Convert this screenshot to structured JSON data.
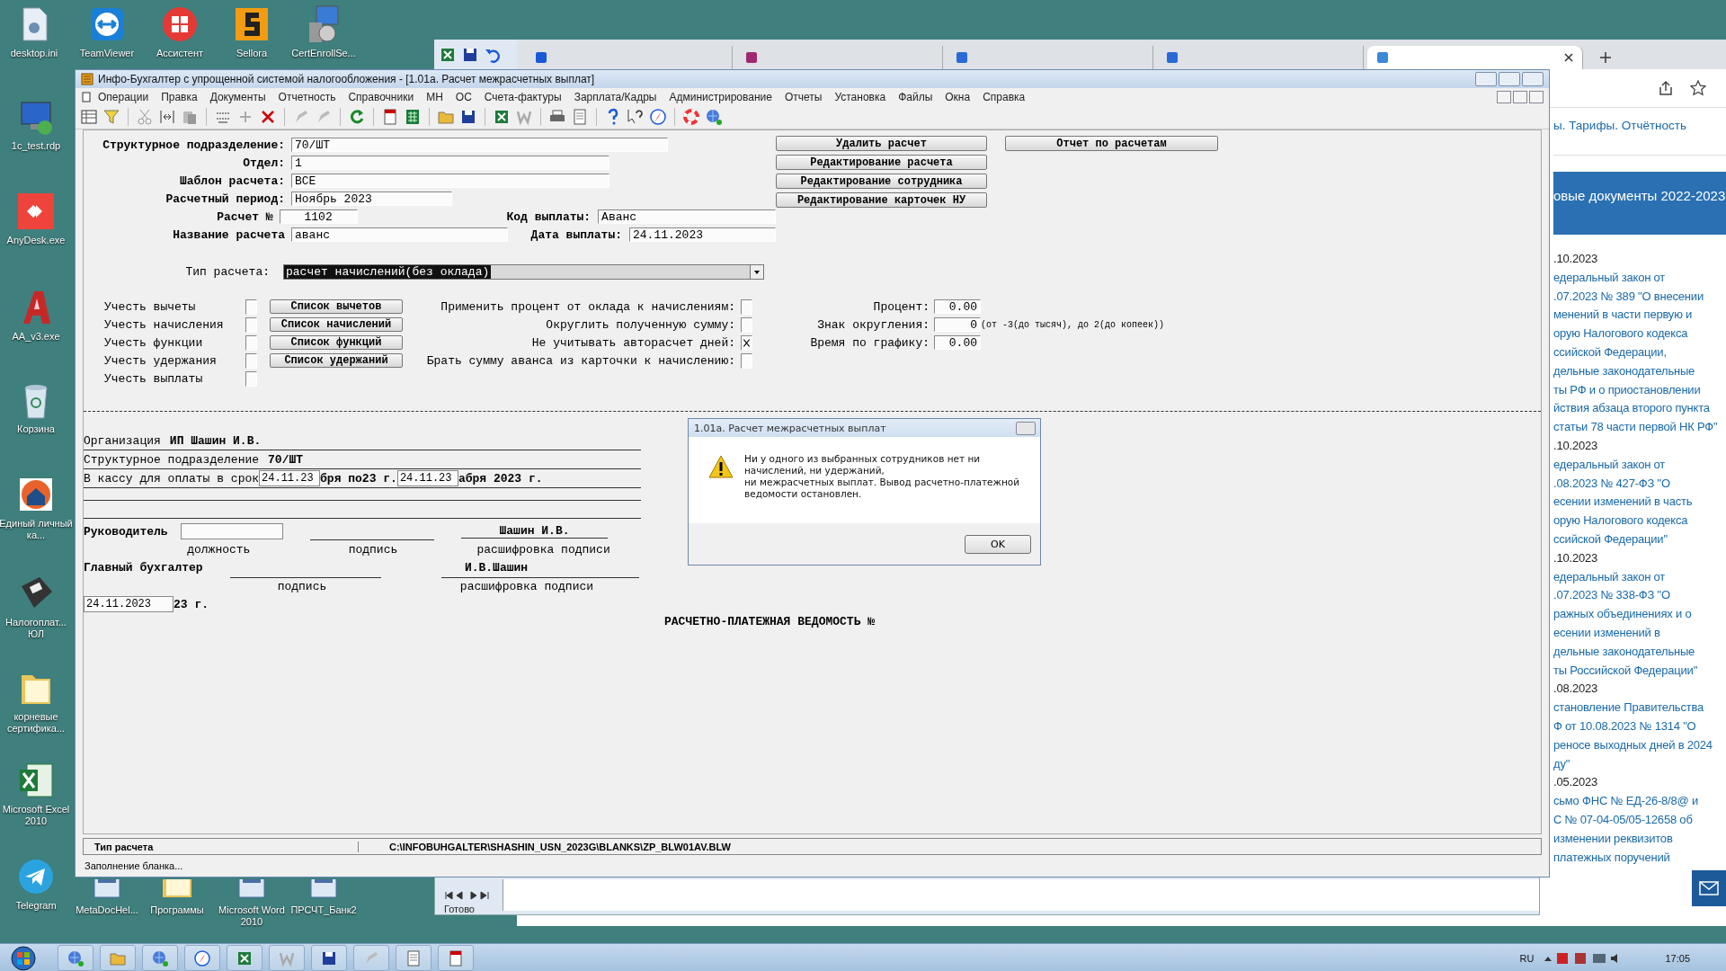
{
  "desktop_icons": [
    {
      "label": "desktop.ini"
    },
    {
      "label": "TeamViewer"
    },
    {
      "label": "Ассистент"
    },
    {
      "label": "Sellora"
    },
    {
      "label": "CertEnrollSe..."
    },
    {
      "label": "1c_test.rdp"
    },
    {
      "label": "AnyDesk.exe"
    },
    {
      "label": "AA_v3.exe"
    },
    {
      "label": "Корзина"
    },
    {
      "label": "Единый личный ка..."
    },
    {
      "label": "Налогоплат... ЮЛ"
    },
    {
      "label": "корневые сертифика..."
    },
    {
      "label": "Microsoft Excel 2010"
    },
    {
      "label": "Telegram"
    },
    {
      "label": "MetaDocHel..."
    },
    {
      "label": "Программы"
    },
    {
      "label": "Microsoft Word 2010"
    },
    {
      "label": "ПРСЧТ_Банк2"
    }
  ],
  "browser": {
    "tabs": [
      {
        "selected": false
      },
      {
        "selected": false
      },
      {
        "selected": false
      },
      {
        "selected": false
      },
      {
        "selected": true
      }
    ],
    "breadcrumb": "ы. Тарифы. Отчётность",
    "banner": "овые документы 2022-2023",
    "lines": [
      {
        "kind": "date",
        "text": ".10.2023"
      },
      {
        "kind": "link",
        "text": "едеральный закон от"
      },
      {
        "kind": "link",
        "text": ".07.2023 № 389 \"О внесении"
      },
      {
        "kind": "link",
        "text": "менений в части первую и"
      },
      {
        "kind": "link",
        "text": "орую Налогового кодекса"
      },
      {
        "kind": "link",
        "text": "ссийской Федерации,"
      },
      {
        "kind": "link",
        "text": "дельные законодательные"
      },
      {
        "kind": "link",
        "text": "ты РФ и о приостановлении"
      },
      {
        "kind": "link",
        "text": "йствия абзаца второго пункта"
      },
      {
        "kind": "link",
        "text": "статьи 78 части первой НК РФ\""
      },
      {
        "kind": "date",
        "text": ".10.2023"
      },
      {
        "kind": "link",
        "text": "едеральный закон от"
      },
      {
        "kind": "link",
        "text": ".08.2023 № 427-ФЗ \"О"
      },
      {
        "kind": "link",
        "text": "есении изменений в часть"
      },
      {
        "kind": "link",
        "text": "орую Налогового кодекса"
      },
      {
        "kind": "link",
        "text": "ссийской Федерации\""
      },
      {
        "kind": "date",
        "text": ".10.2023"
      },
      {
        "kind": "link",
        "text": "едеральный закон от"
      },
      {
        "kind": "link",
        "text": ".07.2023 № 338-ФЗ \"О"
      },
      {
        "kind": "link",
        "text": "ражных объединениях и о"
      },
      {
        "kind": "link",
        "text": "есении изменений в"
      },
      {
        "kind": "link",
        "text": "дельные законодательные"
      },
      {
        "kind": "link",
        "text": "ты Российской Федерации\""
      },
      {
        "kind": "date",
        "text": ".08.2023"
      },
      {
        "kind": "link",
        "text": "становление Правительства"
      },
      {
        "kind": "link",
        "text": "Ф от 10.08.2023 № 1314 \"О"
      },
      {
        "kind": "link",
        "text": "реносе выходных дней в 2024"
      },
      {
        "kind": "link",
        "text": "ду\""
      },
      {
        "kind": "date",
        "text": ".05.2023"
      },
      {
        "kind": "link",
        "text": "сьмо ФНС № ЕД-26-8/8@ и"
      },
      {
        "kind": "link",
        "text": "С № 07-04-05/05-12658 об"
      },
      {
        "kind": "link",
        "text": "изменении реквизитов"
      },
      {
        "kind": "link",
        "text": "платежных поручений"
      }
    ]
  },
  "excel": {
    "status": "Готово"
  },
  "main_window": {
    "title": "Инфо-Бухгалтер с упрощенной системой налогообложения - [1.01а. Расчет межрасчетных выплат]",
    "menu": [
      "Операции",
      "Правка",
      "Документы",
      "Отчетность",
      "Справочники",
      "МН",
      "ОС",
      "Счета-фактуры",
      "Зарплата/Кадры",
      "Администрирование",
      "Отчеты",
      "Установка",
      "Файлы",
      "Окна",
      "Справка"
    ],
    "fields": [
      {
        "label": "Структурное подразделение:",
        "value": "70/ШТ"
      },
      {
        "label": "Отдел:",
        "value": "1"
      },
      {
        "label": "Шаблон расчета:",
        "value": "ВСЕ"
      },
      {
        "label": "Расчетный период:",
        "value": "Ноябрь 2023"
      },
      {
        "label": "Расчет №",
        "value": "1102",
        "extra": {
          "label": "Код выплаты:",
          "value": "Аванс"
        }
      },
      {
        "label": "Название расчета",
        "value": "аванс",
        "extra": {
          "label": "Дата выплаты:",
          "value": "24.11.2023"
        }
      }
    ],
    "actions": [
      "Удалить расчет",
      "Редактирование расчета",
      "Редактирование сотрудника",
      "Редактирование карточек НУ"
    ],
    "report_button": "Отчет по расчетам",
    "calc_type": {
      "label": "Тип расчета:",
      "value": "расчет начислений(без оклада)"
    },
    "options": [
      {
        "label": "Учесть вычеты",
        "checked": false,
        "button": "Список вычетов"
      },
      {
        "label": "Учесть начисления",
        "checked": false,
        "button": "Список начислений"
      },
      {
        "label": "Учесть функции",
        "checked": false,
        "button": "Список функций"
      },
      {
        "label": "Учесть удержания",
        "checked": false,
        "button": "Список удержаний"
      },
      {
        "label": "Учесть выплаты",
        "checked": false
      }
    ],
    "settings": [
      {
        "label": "Применить процент от оклада к начислениям:",
        "checked": false
      },
      {
        "label": "Округлить полученную сумму:",
        "checked": false
      },
      {
        "label": "Не учитывать авторасчет дней:",
        "checked": true
      },
      {
        "label": "Брать сумму аванса из карточки к начислению:",
        "checked": false
      }
    ],
    "params": [
      {
        "label": "Процент:",
        "value": "0.00"
      },
      {
        "label": "Знак округления:",
        "value": "0",
        "hint": "(от -3(до тысяч), до 2(до копеек))"
      },
      {
        "label": "Время по графику:",
        "value": "0.00"
      }
    ],
    "report": {
      "org_label": "Организация",
      "org": "ИП Шашин И.В.",
      "unit_label": "Структурное подразделение",
      "unit": "70/ШТ",
      "cash_label": "В кассу для оплаты в срок",
      "date_from": "24.11.23",
      "middle": "бря по23 г.",
      "date_to": "24.11.23",
      "end": "абря 2023 г.",
      "head_label": "Руководитель",
      "head_name": "Шашин И.В.",
      "head_captions": [
        "должность",
        "подпись",
        "расшифровка подписи"
      ],
      "accountant_label": "Главный бухгалтер",
      "accountant_name": "И.В.Шашин",
      "accountant_captions": [
        "подпись",
        "расшифровка подписи"
      ],
      "date": "24.11.2023",
      "date_suffix": "23 г.",
      "title": "РАСЧЕТНО-ПЛАТЕЖНАЯ ВЕДОМОСТЬ №"
    },
    "status_bar": {
      "field": "Тип расчета",
      "path": "C:\\INFOBUHGALTER\\SHASHIN_USN_2023G\\BLANKS\\ZP_BLW01AV.BLW"
    },
    "message": "Заполнение бланка..."
  },
  "dialog": {
    "title": "1.01а. Расчет межрасчетных выплат",
    "lines": [
      "Ни у одного из выбранных сотрудников нет ни",
      "начислений, ни удержаний,",
      "ни межрасчетных выплат. Вывод расчетно-платежной",
      "ведомости остановлен."
    ],
    "button": "OK"
  },
  "taskbar": {
    "language": "RU",
    "time": "17:05"
  }
}
